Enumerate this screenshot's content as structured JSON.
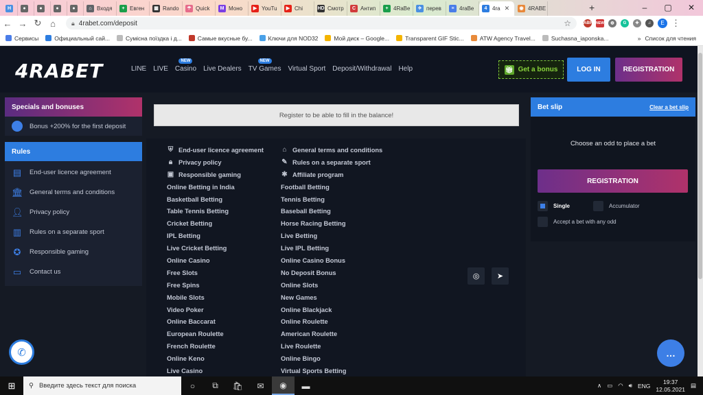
{
  "browser": {
    "tabs": [
      {
        "label": "",
        "color": "#4a90e2",
        "glyph": "H"
      },
      {
        "label": "",
        "color": "#666666",
        "glyph": "●"
      },
      {
        "label": "",
        "color": "#666666",
        "glyph": "●"
      },
      {
        "label": "",
        "color": "#666666",
        "glyph": "●"
      },
      {
        "label": "",
        "color": "#666666",
        "glyph": "●"
      },
      {
        "label": "Входя",
        "color": "#5f6368",
        "glyph": "⌂"
      },
      {
        "label": "Евген",
        "color": "#1a9e4a",
        "glyph": "+"
      },
      {
        "label": "Rando",
        "color": "#333333",
        "glyph": "▦"
      },
      {
        "label": "Quick",
        "color": "#e66b8a",
        "glyph": "☂"
      },
      {
        "label": "Моно",
        "color": "#7b3fe4",
        "glyph": "M"
      },
      {
        "label": "YouTu",
        "color": "#e62117",
        "glyph": "▶"
      },
      {
        "label": "Chi",
        "color": "#e62117",
        "glyph": "▶"
      },
      {
        "label": "Смотр",
        "color": "#333333",
        "glyph": "HD"
      },
      {
        "label": "Антип",
        "color": "#d13b3b",
        "glyph": "C"
      },
      {
        "label": "4RaBe",
        "color": "#1a9e4a",
        "glyph": "+"
      },
      {
        "label": "перев",
        "color": "#4a90e2",
        "glyph": "✈"
      },
      {
        "label": "4raBe",
        "color": "#4a7de8",
        "glyph": "≡"
      },
      {
        "label": "4ra",
        "color": "#2d7de0",
        "glyph": "4",
        "active": true
      },
      {
        "label": "4RABE",
        "color": "#e8883a",
        "glyph": "◉"
      }
    ],
    "url": "4rabet.com/deposit",
    "bookmarks": [
      {
        "label": "Сервисы",
        "color": "#4a7de8"
      },
      {
        "label": "Официальный сай...",
        "color": "#2d7de0"
      },
      {
        "label": "Сумісна поїздка і д...",
        "color": "#bbbbbb"
      },
      {
        "label": "Самые вкусные бу...",
        "color": "#c0392b"
      },
      {
        "label": "Ключи для NOD32",
        "color": "#4aa1e8"
      },
      {
        "label": "Мой диск – Google...",
        "color": "#f4b400"
      },
      {
        "label": "Transparent GIF Stic...",
        "color": "#f4b400"
      },
      {
        "label": "ATW Agency Travel...",
        "color": "#e88a3a"
      },
      {
        "label": "Suchasna_iaponska...",
        "color": "#bbbbbb"
      }
    ],
    "bookmarks_more": "»",
    "reading_list": "Список для чтения",
    "profile_initial": "E",
    "ext_new_badge": "NEW"
  },
  "site": {
    "logo": "4RABET",
    "nav": [
      {
        "label": "LINE",
        "new": false
      },
      {
        "label": "LIVE",
        "new": false
      },
      {
        "label": "Casino",
        "new": true
      },
      {
        "label": "Live Dealers",
        "new": false
      },
      {
        "label": "TV Games",
        "new": true
      },
      {
        "label": "Virtual Sport",
        "new": false
      },
      {
        "label": "Deposit/Withdrawal",
        "new": false
      },
      {
        "label": "Help",
        "new": false
      }
    ],
    "new_badge": "NEW",
    "bonus_label": "Get a bonus",
    "login_label": "LOG IN",
    "register_label": "REGISTRATION",
    "specials": {
      "title": "Specials and bonuses",
      "item": "Bonus +200% for the first deposit"
    },
    "rules": {
      "title": "Rules",
      "items": [
        {
          "label": "End-user licence agreement",
          "icon": "document-icon"
        },
        {
          "label": "General terms and conditions",
          "icon": "bank-icon"
        },
        {
          "label": "Privacy policy",
          "icon": "user-lock-icon"
        },
        {
          "label": "Rules on a separate sport",
          "icon": "podium-icon"
        },
        {
          "label": "Responsible gaming",
          "icon": "medal-icon"
        },
        {
          "label": "Contact us",
          "icon": "chat-icon"
        }
      ]
    },
    "notice": "Register to be able to fill in the balance!",
    "links_col1": [
      {
        "label": "End-user licence agreement",
        "icon": "⛨"
      },
      {
        "label": "Privacy policy",
        "icon": "🔒︎"
      },
      {
        "label": "Responsible gaming",
        "icon": "▣"
      },
      {
        "label": "Online Betting in India"
      },
      {
        "label": "Basketball Betting"
      },
      {
        "label": "Table Tennis Betting"
      },
      {
        "label": "Cricket Betting"
      },
      {
        "label": "IPL Betting"
      },
      {
        "label": "Live Cricket Betting"
      },
      {
        "label": "Online Casino"
      },
      {
        "label": "Free Slots"
      },
      {
        "label": "Free Spins"
      },
      {
        "label": "Mobile Slots"
      },
      {
        "label": "Video Poker"
      },
      {
        "label": "Online Baccarat"
      },
      {
        "label": "European Roulette"
      },
      {
        "label": "French Roulette"
      },
      {
        "label": "Online Keno"
      },
      {
        "label": "Live Casino"
      }
    ],
    "links_col2": [
      {
        "label": "General terms and conditions",
        "icon": "⌂"
      },
      {
        "label": "Rules on a separate sport",
        "icon": "✎"
      },
      {
        "label": "Affiliate program",
        "icon": "✱"
      },
      {
        "label": "Football Betting"
      },
      {
        "label": "Tennis Betting"
      },
      {
        "label": "Baseball Betting"
      },
      {
        "label": "Horse Racing Betting"
      },
      {
        "label": "Live Betting"
      },
      {
        "label": "Live IPL Betting"
      },
      {
        "label": "Online Casino Bonus"
      },
      {
        "label": "No Deposit Bonus"
      },
      {
        "label": "Online Slots"
      },
      {
        "label": "New Games"
      },
      {
        "label": "Online Blackjack"
      },
      {
        "label": "Online Roulette"
      },
      {
        "label": "American Roulette"
      },
      {
        "label": "Live Roulette"
      },
      {
        "label": "Online Bingo"
      },
      {
        "label": "Virtual Sports Betting"
      }
    ],
    "betslip": {
      "title": "Bet slip",
      "clear": "Clear a bet slip",
      "empty": "Choose an odd to place a bet",
      "register": "REGISTRATION",
      "single": "Single",
      "accumulator": "Accumulator",
      "accept": "Accept a bet with any odd"
    }
  },
  "taskbar": {
    "search_placeholder": "Введите здесь текст для поиска",
    "lang": "ENG",
    "time": "19:37",
    "date": "12.05.2021"
  },
  "colors": {
    "accent_blue": "#2d7de0",
    "accent_gradient_start": "#6d2f8a",
    "accent_gradient_end": "#b0326a",
    "bonus_green": "#8ad43c",
    "site_bg": "#151a24"
  }
}
